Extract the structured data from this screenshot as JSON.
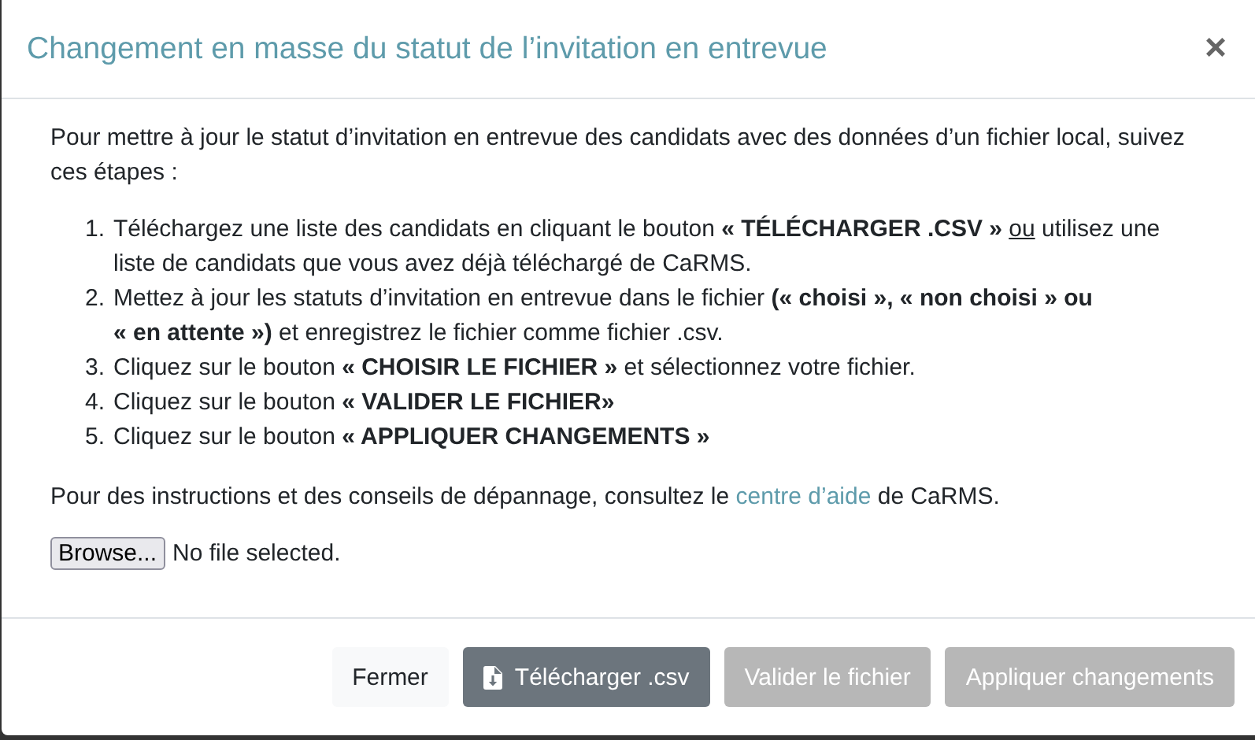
{
  "modal": {
    "title": "Changement en masse du statut de l’invitation en entrevue",
    "close": "×"
  },
  "intro": "Pour mettre à jour le statut d’invitation en entrevue des candidats avec des données d’un fichier local, suivez ces étapes :",
  "steps": [
    {
      "marker": "1.",
      "parts": [
        {
          "kind": "plain",
          "text": "Téléchargez une liste des candidats en cliquant le bouton **« TÉLÉCHARGER .CSV »** "
        },
        {
          "kind": "underline",
          "text": "ou"
        },
        {
          "kind": "plain",
          "text": " utilisez une liste de candidats que vous avez déjà téléchargé de CaRMS."
        }
      ]
    },
    {
      "marker": "2.",
      "parts": [
        {
          "kind": "plain",
          "text": "Mettez à jour les statuts d’invitation en entrevue dans le fichier **(« choisi », « non choisi » ou « en attente »)** et enregistrez le fichier comme fichier .csv."
        }
      ]
    },
    {
      "marker": "3.",
      "parts": [
        {
          "kind": "plain",
          "text": "Cliquez sur le bouton **« CHOISIR LE FICHIER »** et sélectionnez votre fichier."
        }
      ]
    },
    {
      "marker": "4.",
      "parts": [
        {
          "kind": "plain",
          "text": "Cliquez sur le bouton **« VALIDER LE FICHIER»**"
        }
      ]
    },
    {
      "marker": "5.",
      "parts": [
        {
          "kind": "plain",
          "text": "Cliquez sur le bouton **« APPLIQUER CHANGEMENTS »**"
        }
      ]
    }
  ],
  "help": {
    "before": "Pour des instructions et des conseils de dépannage, consultez le",
    "link": "centre d’aide",
    "after": "de CaRMS."
  },
  "file": {
    "button": "Browse...",
    "status": "No file selected."
  },
  "buttons": [
    {
      "label": "Fermer",
      "kind": "light",
      "disabled": false
    },
    {
      "label": "Télécharger .csv",
      "kind": "download",
      "disabled": false
    },
    {
      "label": "Valider le fichier",
      "kind": "secondary",
      "disabled": true
    },
    {
      "label": "Appliquer changements",
      "kind": "secondary",
      "disabled": true
    }
  ]
}
